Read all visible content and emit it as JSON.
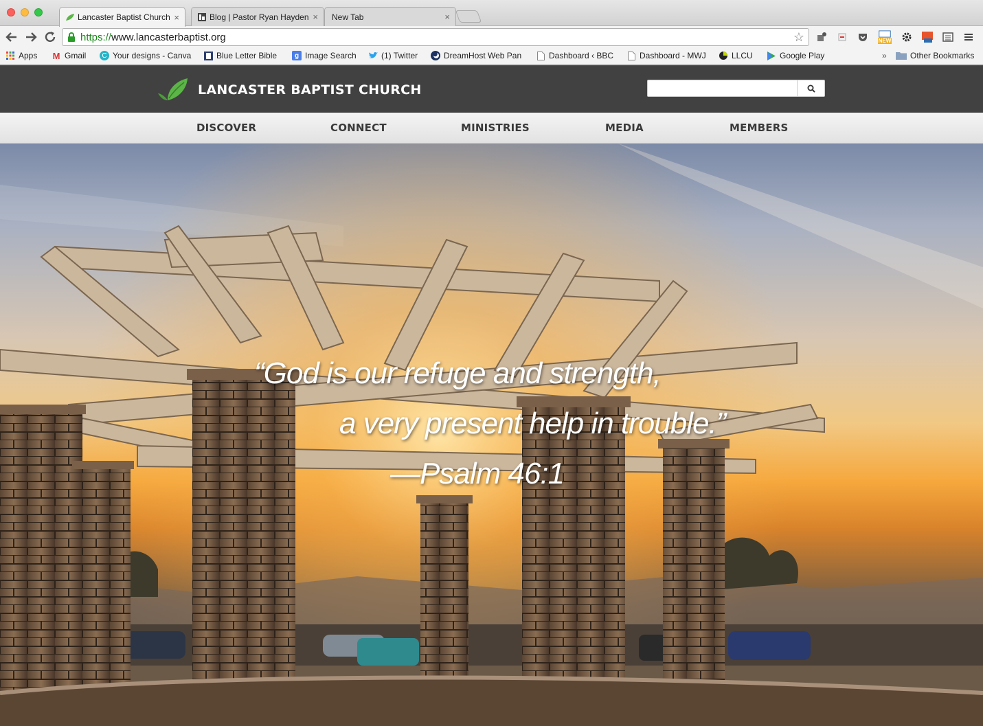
{
  "browser": {
    "tabs": [
      {
        "title": "Lancaster Baptist Church | L",
        "close": "×",
        "active": true
      },
      {
        "title": "Blog | Pastor Ryan Hayden",
        "close": "×",
        "active": false
      },
      {
        "title": "New Tab",
        "close": "×",
        "active": false
      }
    ],
    "url_scheme": "https://",
    "url_host": "www.lancasterbaptist.org",
    "new_badge": "NEW",
    "bookmarks": [
      {
        "label": "Apps",
        "icon": "apps-grid-icon"
      },
      {
        "label": "Gmail",
        "icon": "gmail-icon"
      },
      {
        "label": "Your designs - Canva",
        "icon": "canva-icon"
      },
      {
        "label": "Blue Letter Bible",
        "icon": "bible-icon"
      },
      {
        "label": "Image Search",
        "icon": "google-icon"
      },
      {
        "label": "(1) Twitter",
        "icon": "twitter-icon"
      },
      {
        "label": "DreamHost Web Pan",
        "icon": "dreamhost-icon"
      },
      {
        "label": "Dashboard ‹ BBC",
        "icon": "page-icon"
      },
      {
        "label": "Dashboard - MWJ",
        "icon": "page-icon"
      },
      {
        "label": "LLCU",
        "icon": "llcu-icon"
      },
      {
        "label": "Google Play",
        "icon": "google-play-icon"
      }
    ],
    "bookmarks_overflow": "»",
    "other_bookmarks": "Other Bookmarks"
  },
  "site": {
    "title": "LANCASTER BAPTIST CHURCH",
    "search_placeholder": "",
    "nav": [
      "DISCOVER",
      "CONNECT",
      "MINISTRIES",
      "MEDIA",
      "MEMBERS"
    ]
  },
  "hero": {
    "line1": "“God is our refuge and strength,",
    "line2": "a very present help in trouble.”",
    "reference": "—Psalm 46:1"
  },
  "colors": {
    "header_bg": "#414141",
    "nav_bg": "#ececec",
    "leaf_green": "#5bb547",
    "url_green": "#1a8a1a"
  }
}
